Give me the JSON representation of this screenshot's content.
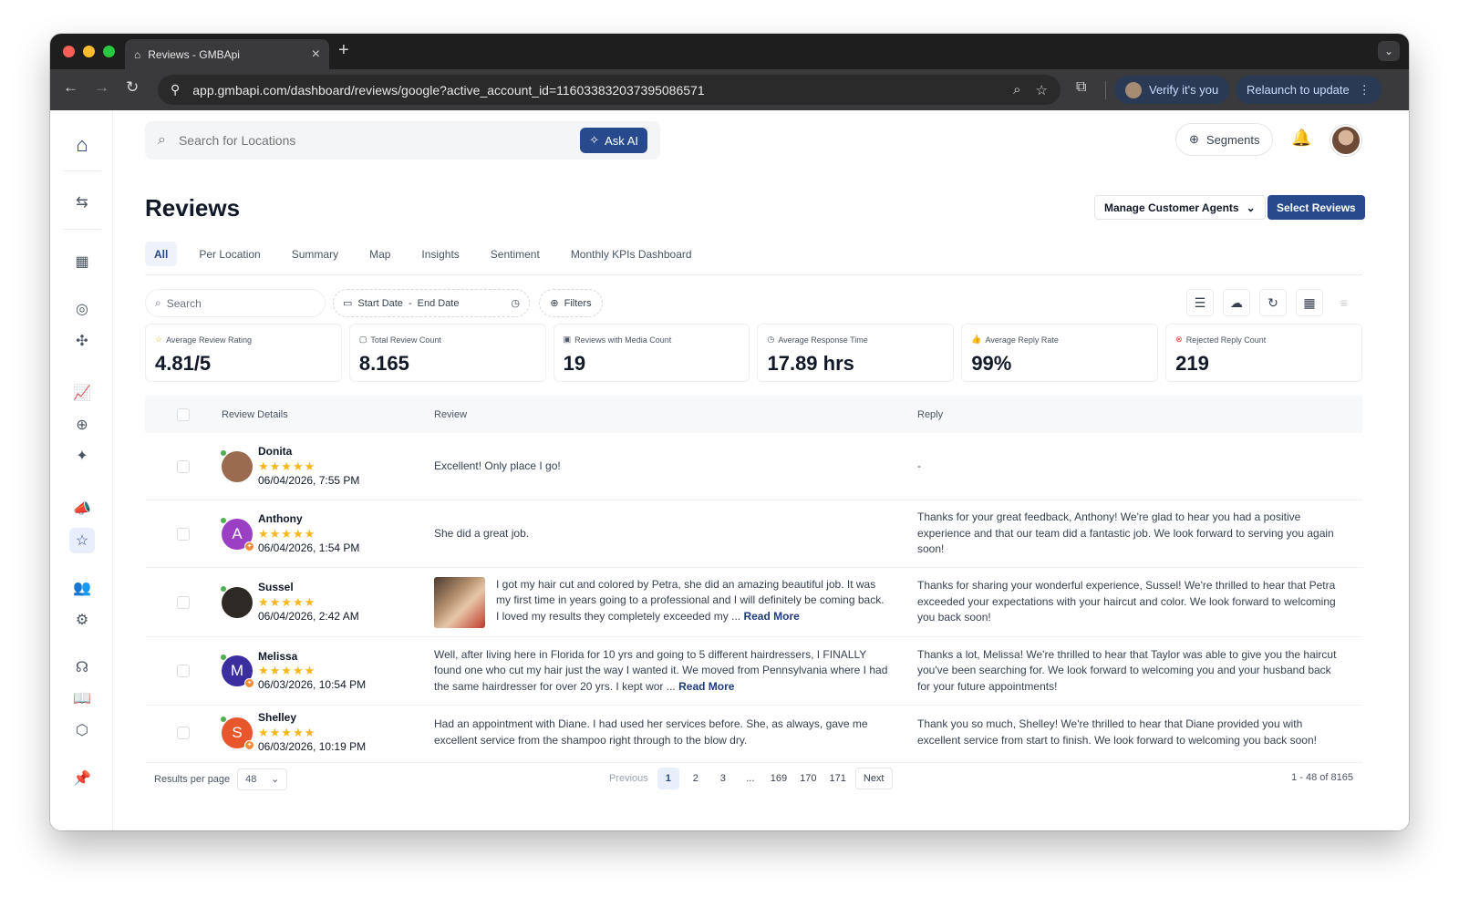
{
  "browser": {
    "tab_title": "Reviews - GMBApi",
    "url": "app.gmbapi.com/dashboard/reviews/google?active_account_id=116033832037395086571",
    "verify_label": "Verify it's you",
    "relaunch_label": "Relaunch to update"
  },
  "header": {
    "search_placeholder": "Search for Locations",
    "ask_ai_label": "Ask AI",
    "segments_label": "Segments"
  },
  "page": {
    "title": "Reviews",
    "manage_agents_label": "Manage Customer Agents",
    "select_reviews_label": "Select Reviews"
  },
  "tabs": [
    "All",
    "Per Location",
    "Summary",
    "Map",
    "Insights",
    "Sentiment",
    "Monthly KPIs Dashboard"
  ],
  "filters": {
    "search_placeholder": "Search",
    "start_date": "Start Date",
    "date_sep": "-",
    "end_date": "End Date",
    "filters_label": "Filters"
  },
  "kpis": [
    {
      "label": "Average Review Rating",
      "value": "4.81/5",
      "icon": "star-icon"
    },
    {
      "label": "Total Review Count",
      "value": "8.165",
      "icon": "message-icon"
    },
    {
      "label": "Reviews with Media Count",
      "value": "19",
      "icon": "image-icon"
    },
    {
      "label": "Average Response Time",
      "value": "17.89 hrs",
      "icon": "clock-icon"
    },
    {
      "label": "Average Reply Rate",
      "value": "99%",
      "icon": "thumbs-up-icon"
    },
    {
      "label": "Rejected Reply Count",
      "value": "219",
      "icon": "x-circle-icon"
    }
  ],
  "table": {
    "headers": {
      "details": "Review Details",
      "review": "Review",
      "reply": "Reply"
    },
    "read_more": "Read More",
    "rows": [
      {
        "name": "Donita",
        "initial": "",
        "avatar_color": "#9a6b4f",
        "rating": 5,
        "stars": "★★★★★",
        "date": "06/04/2026, 7:55 PM",
        "review": "Excellent! Only place I go!",
        "has_media": false,
        "truncated": false,
        "reply": "-"
      },
      {
        "name": "Anthony",
        "initial": "A",
        "avatar_color": "#9b3fc4",
        "rating": 5,
        "stars": "★★★★★",
        "date": "06/04/2026, 1:54 PM",
        "review": "She did a great job.",
        "has_media": false,
        "truncated": false,
        "reply": "Thanks for your great feedback, Anthony! We're glad to hear you had a positive experience and that our team did a fantastic job. We look forward to serving you again soon!"
      },
      {
        "name": "Sussel",
        "initial": "",
        "avatar_color": "#2d2a26",
        "rating": 5,
        "stars": "★★★★★",
        "date": "06/04/2026, 2:42 AM",
        "review": "I got my hair cut and colored by Petra, she did an amazing beautiful job. It was my first time in years going to a professional and I will definitely be coming back. I loved my results they completely exceeded my ...",
        "has_media": true,
        "truncated": true,
        "reply": "Thanks for sharing your wonderful experience, Sussel! We're thrilled to hear that Petra exceeded your expectations with your haircut and color. We look forward to welcoming you back soon!"
      },
      {
        "name": "Melissa",
        "initial": "M",
        "avatar_color": "#3b2e9e",
        "rating": 5,
        "stars": "★★★★★",
        "date": "06/03/2026, 10:54 PM",
        "review": "Well, after living here in Florida for 10 yrs and going to 5 different hairdressers, I FINALLY found one who cut my hair just the way I wanted it. We moved from Pennsylvania where I had the same hairdresser for over 20 yrs. I kept wor ...",
        "has_media": false,
        "truncated": true,
        "reply": "Thanks a lot, Melissa! We're thrilled to hear that Taylor was able to give you the haircut you've been searching for. We look forward to welcoming you and your husband back for your future appointments!"
      },
      {
        "name": "Shelley",
        "initial": "S",
        "avatar_color": "#e8562c",
        "rating": 5,
        "stars": "★★★★★",
        "date": "06/03/2026, 10:19 PM",
        "review": "Had an appointment with Diane. I had used her services before. She, as always, gave me excellent service from the shampoo right through to the blow dry.",
        "has_media": false,
        "truncated": false,
        "reply": "Thank you so much, Shelley! We're thrilled to hear that Diane provided you with excellent service from start to finish. We look forward to welcoming you back soon!"
      }
    ]
  },
  "pagination": {
    "results_per_page_label": "Results per page",
    "per_page_value": "48",
    "previous": "Previous",
    "next": "Next",
    "pages": [
      "1",
      "2",
      "3",
      "...",
      "169",
      "170",
      "171"
    ],
    "current": "1",
    "range_text": "1 - 48 of 8165"
  },
  "colors": {
    "brand": "#274a8c",
    "star": "#f5b81c",
    "online": "#4caf50"
  }
}
